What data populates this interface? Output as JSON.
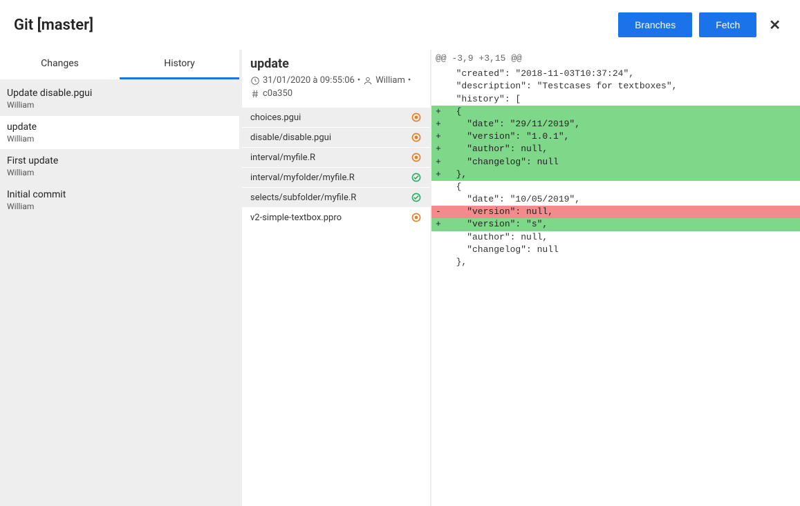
{
  "header": {
    "title": "Git [master]",
    "branches_label": "Branches",
    "fetch_label": "Fetch",
    "close_glyph": "✕"
  },
  "tabs": {
    "changes": "Changes",
    "history": "History"
  },
  "commits": [
    {
      "title": "Update disable.pgui",
      "author": "William",
      "selected": false
    },
    {
      "title": "update",
      "author": "William",
      "selected": true
    },
    {
      "title": "First update",
      "author": "William",
      "selected": false
    },
    {
      "title": "Initial commit",
      "author": "William",
      "selected": false
    }
  ],
  "commit_detail": {
    "title": "update",
    "datetime": "31/01/2020 à 09:55:06",
    "author": "William",
    "hash": "c0a350",
    "sep": "•"
  },
  "files": [
    {
      "name": "choices.pgui",
      "status": "modified",
      "selected": false
    },
    {
      "name": "disable/disable.pgui",
      "status": "modified",
      "selected": false
    },
    {
      "name": "interval/myfile.R",
      "status": "modified",
      "selected": false
    },
    {
      "name": "interval/myfolder/myfile.R",
      "status": "added",
      "selected": false
    },
    {
      "name": "selects/subfolder/myfile.R",
      "status": "added",
      "selected": false
    },
    {
      "name": "v2-simple-textbox.ppro",
      "status": "modified",
      "selected": true
    }
  ],
  "diff": {
    "hunk": "@@ -3,9 +3,15 @@",
    "lines": [
      {
        "type": "ctx",
        "text": "  \"created\": \"2018-11-03T10:37:24\","
      },
      {
        "type": "ctx",
        "text": "  \"description\": \"Testcases for textboxes\","
      },
      {
        "type": "ctx",
        "text": "  \"history\": ["
      },
      {
        "type": "add",
        "text": "  {"
      },
      {
        "type": "add",
        "text": "    \"date\": \"29/11/2019\","
      },
      {
        "type": "add",
        "text": "    \"version\": \"1.0.1\","
      },
      {
        "type": "add",
        "text": "    \"author\": null,"
      },
      {
        "type": "add",
        "text": "    \"changelog\": null"
      },
      {
        "type": "add",
        "text": "  },"
      },
      {
        "type": "ctx",
        "text": "  {"
      },
      {
        "type": "ctx",
        "text": "    \"date\": \"10/05/2019\","
      },
      {
        "type": "del",
        "text": "    \"version\": null,"
      },
      {
        "type": "add",
        "text": "    \"version\": \"s\","
      },
      {
        "type": "ctx",
        "text": "    \"author\": null,"
      },
      {
        "type": "ctx",
        "text": "    \"changelog\": null"
      },
      {
        "type": "ctx",
        "text": "  },"
      }
    ]
  }
}
